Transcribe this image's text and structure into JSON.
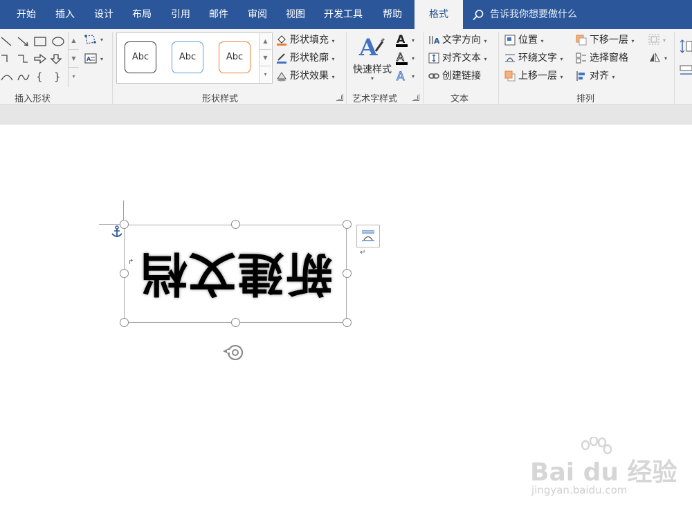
{
  "tabs": [
    {
      "label": "开始",
      "active": false
    },
    {
      "label": "插入",
      "active": false
    },
    {
      "label": "设计",
      "active": false
    },
    {
      "label": "布局",
      "active": false
    },
    {
      "label": "引用",
      "active": false
    },
    {
      "label": "邮件",
      "active": false
    },
    {
      "label": "审阅",
      "active": false
    },
    {
      "label": "视图",
      "active": false
    },
    {
      "label": "开发工具",
      "active": false
    },
    {
      "label": "帮助",
      "active": false
    },
    {
      "label": "格式",
      "active": true
    }
  ],
  "tell_me": "告诉我你想要做什么",
  "ribbon": {
    "insert_shapes": {
      "label": "插入形状"
    },
    "shape_styles": {
      "label": "形状样式",
      "gallery": [
        "Abc",
        "Abc",
        "Abc"
      ],
      "fill": "形状填充",
      "outline": "形状轮廓",
      "effects": "形状效果"
    },
    "wordart": {
      "label": "艺术字样式",
      "quick_styles": "快速样式"
    },
    "text": {
      "label": "文本",
      "direction": "文字方向",
      "align": "对齐文本",
      "link": "创建链接"
    },
    "arrange": {
      "label": "排列",
      "position": "位置",
      "wrap": "环绕文字",
      "forward": "上移一层",
      "backward": "下移一层",
      "selection_pane": "选择窗格",
      "align": "对齐"
    }
  },
  "document": {
    "textbox_text": "新建文档"
  },
  "watermark": {
    "main": "Bai du 经验",
    "sub": "jingyan.baidu.com"
  },
  "colors": {
    "accent": "#2b579a",
    "ribbon_bg": "#f3f3f3",
    "fill_orange": "#ed7d31",
    "outline_blue": "#4472c4",
    "abc2_border": "#5b9bd5",
    "abc3_border": "#ed7d31"
  }
}
